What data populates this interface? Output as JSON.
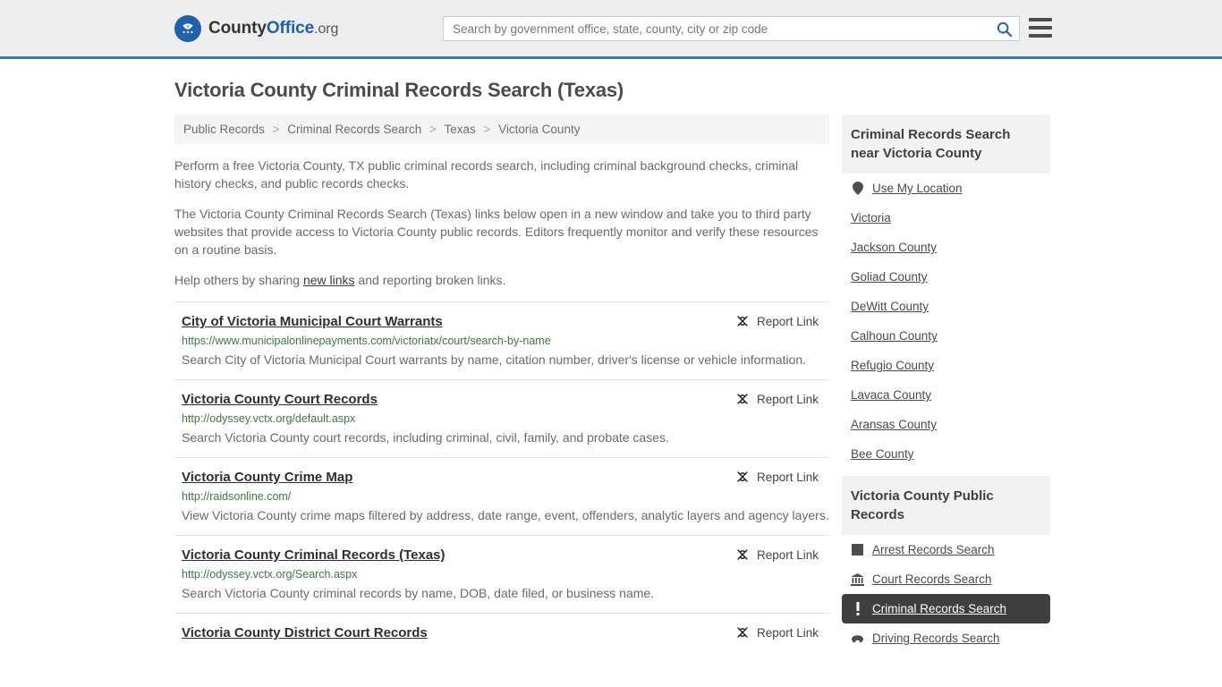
{
  "header": {
    "logo": {
      "text_county": "County",
      "text_office": "Office",
      "text_org": ".org",
      "icon": "eagle-seal-icon"
    },
    "search": {
      "placeholder": "Search by government office, state, county, city or zip code",
      "value": "",
      "button_icon": "search-icon"
    },
    "menu_icon": "hamburger-menu-icon"
  },
  "page": {
    "title": "Victoria County Criminal Records Search (Texas)"
  },
  "breadcrumb": {
    "items": [
      "Public Records",
      "Criminal Records Search",
      "Texas",
      "Victoria County"
    ],
    "separator": ">"
  },
  "intro": {
    "paragraph1": "Perform a free Victoria County, TX public criminal records search, including criminal background checks, criminal history checks, and public records checks.",
    "paragraph2": "The Victoria County Criminal Records Search (Texas) links below open in a new window and take you to third party websites that provide access to Victoria County public records. Editors frequently monitor and verify these resources on a routine basis.",
    "paragraph3_before": "Help others by sharing ",
    "paragraph3_link": "new links",
    "paragraph3_after": " and reporting broken links."
  },
  "results": {
    "report_label": "Report Link",
    "report_icon": "broken-link-icon",
    "items": [
      {
        "title": "City of Victoria Municipal Court Warrants",
        "url": "https://www.municipalonlinepayments.com/victoriatx/court/search-by-name",
        "description": "Search City of Victoria Municipal Court warrants by name, citation number, driver's license or vehicle information."
      },
      {
        "title": "Victoria County Court Records",
        "url": "http://odyssey.vctx.org/default.aspx",
        "description": "Search Victoria County court records, including criminal, civil, family, and probate cases."
      },
      {
        "title": "Victoria County Crime Map",
        "url": "http://raidsonline.com/",
        "description": "View Victoria County crime maps filtered by address, date range, event, offenders, analytic layers and agency layers."
      },
      {
        "title": "Victoria County Criminal Records (Texas)",
        "url": "http://odyssey.vctx.org/Search.aspx",
        "description": "Search Victoria County criminal records by name, DOB, date filed, or business name."
      },
      {
        "title": "Victoria County District Court Records",
        "url": "",
        "description": ""
      }
    ]
  },
  "sidebar": {
    "nearby": {
      "title": "Criminal Records Search near Victoria County",
      "items": [
        {
          "label": "Use My Location",
          "icon": "map-pin-icon",
          "active": false
        },
        {
          "label": "Victoria",
          "icon": "",
          "active": false
        },
        {
          "label": "Jackson County",
          "icon": "",
          "active": false
        },
        {
          "label": "Goliad County",
          "icon": "",
          "active": false
        },
        {
          "label": "DeWitt County",
          "icon": "",
          "active": false
        },
        {
          "label": "Calhoun County",
          "icon": "",
          "active": false
        },
        {
          "label": "Refugio County",
          "icon": "",
          "active": false
        },
        {
          "label": "Lavaca County",
          "icon": "",
          "active": false
        },
        {
          "label": "Aransas County",
          "icon": "",
          "active": false
        },
        {
          "label": "Bee County",
          "icon": "",
          "active": false
        }
      ]
    },
    "public_records": {
      "title": "Victoria County Public Records",
      "items": [
        {
          "label": "Arrest Records Search",
          "icon": "handcuffs-icon",
          "active": false
        },
        {
          "label": "Court Records Search",
          "icon": "courthouse-icon",
          "active": false
        },
        {
          "label": "Criminal Records Search",
          "icon": "alert-exclamation-icon",
          "active": true
        },
        {
          "label": "Driving Records Search",
          "icon": "car-icon",
          "active": false
        }
      ]
    }
  },
  "colors": {
    "header_bg": "#eeeeee",
    "header_border": "#3a78ad",
    "brand_blue": "#1d62ab",
    "url_green": "#3d7a3d",
    "active_bg": "#3f3f3f",
    "panel_bg": "#f2f2f2"
  }
}
